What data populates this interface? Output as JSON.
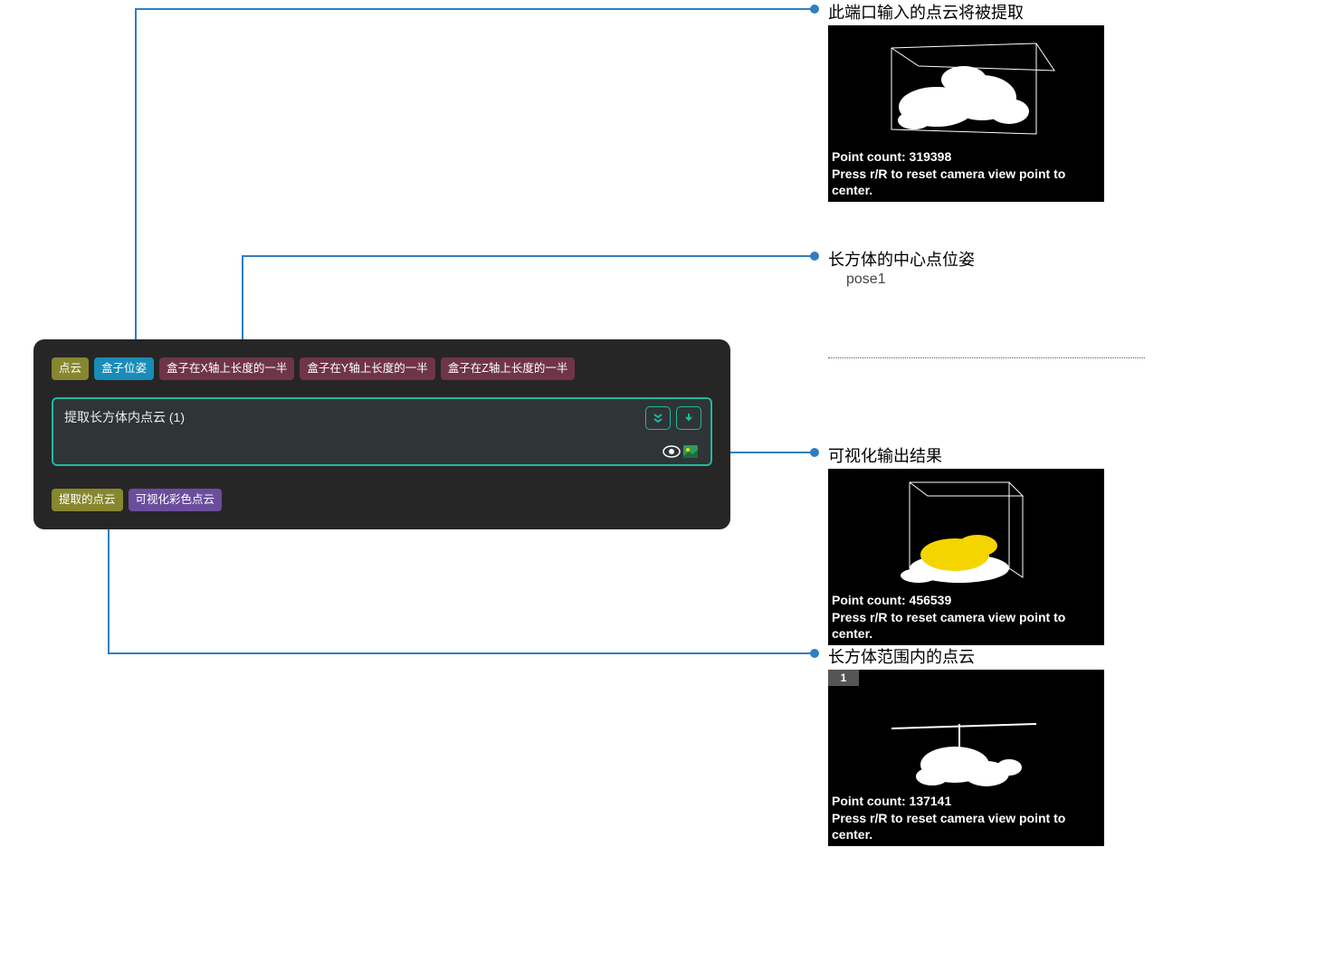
{
  "annotations": {
    "a1": "此端口输入的点云将被提取",
    "a2": "长方体的中心点位姿",
    "a2_sub": "pose1",
    "a3": "可视化输出结果",
    "a4": "长方体范围内的点云"
  },
  "node": {
    "title": "提取长方体内点云 (1)",
    "inputs": [
      {
        "type": "<Cloud(XYZ-Normal) [] >",
        "label": "点云",
        "cls": "olive"
      },
      {
        "type": "<PoseList>",
        "label": "盒子位姿",
        "cls": "cyan"
      },
      {
        "type": "<NumberList->",
        "label": "盒子在X轴上长度的一半",
        "cls": "plum"
      },
      {
        "type": "<NumberList->",
        "label": "盒子在Y轴上长度的一半",
        "cls": "plum"
      },
      {
        "type": "<NumberList->",
        "label": "盒子在Z轴上长度的一半",
        "cls": "plum"
      }
    ],
    "outputs": [
      {
        "type": "<Cloud(XYZ-Normal) [] >",
        "label": "提取的点云",
        "cls": "olive"
      },
      {
        "type": "<Cloud(XYZ-RGB)>",
        "label": "可视化彩色点云",
        "cls": "purple"
      }
    ]
  },
  "previews": {
    "p1": {
      "count_label": "Point count: 319398",
      "reset": "Press r/R to reset camera view point to center."
    },
    "p2": {
      "count_label": "Point count: 456539",
      "reset": "Press r/R to reset camera view point to center."
    },
    "p3": {
      "count_label": "Point count: 137141",
      "reset": "Press r/R to reset camera view point to center.",
      "tab": "1"
    }
  },
  "colors": {
    "line": "#2f7ec1",
    "teal": "#1fb9a0"
  }
}
